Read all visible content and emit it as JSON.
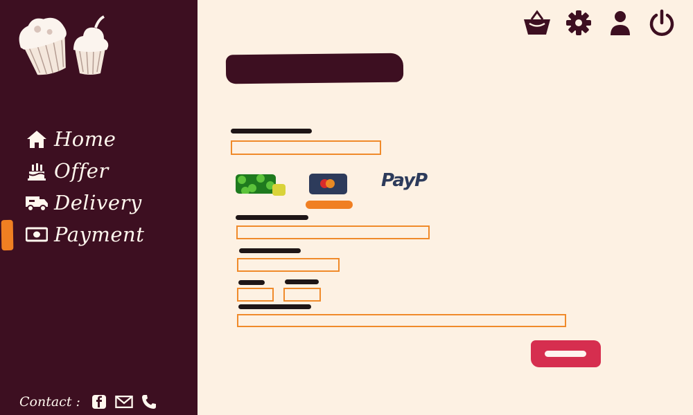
{
  "colors": {
    "sidebar": "#3d0f21",
    "background": "#fdf1e3",
    "accent": "#f07f22",
    "submit": "#d62e4f",
    "text_light": "#fff7ee"
  },
  "sidebar": {
    "logo_icon": "cupcakes-logo-icon",
    "items": [
      {
        "label": "Home",
        "icon": "home-icon",
        "active": false
      },
      {
        "label": "Offer",
        "icon": "cake-icon",
        "active": false
      },
      {
        "label": "Delivery",
        "icon": "truck-icon",
        "active": false
      },
      {
        "label": "Payment",
        "icon": "money-icon",
        "active": true
      }
    ],
    "contact": {
      "label": "Contact :",
      "icons": [
        "facebook-icon",
        "mail-icon",
        "phone-icon"
      ]
    }
  },
  "header": {
    "icons": [
      "basket-icon",
      "gear-icon",
      "user-icon",
      "power-icon"
    ]
  },
  "payment_methods": {
    "options": [
      {
        "icon": "cash-icon",
        "selected": false
      },
      {
        "icon": "credit-card-icon",
        "selected": true
      },
      {
        "label": "PayP",
        "icon": "paypal-icon",
        "selected": false
      }
    ]
  },
  "form": {
    "fields": [
      {
        "value": "",
        "placeholder": ""
      },
      {
        "value": "",
        "placeholder": ""
      },
      {
        "value": "",
        "placeholder": ""
      },
      {
        "value": "",
        "placeholder": ""
      },
      {
        "value": "",
        "placeholder": ""
      },
      {
        "value": "",
        "placeholder": ""
      }
    ]
  }
}
